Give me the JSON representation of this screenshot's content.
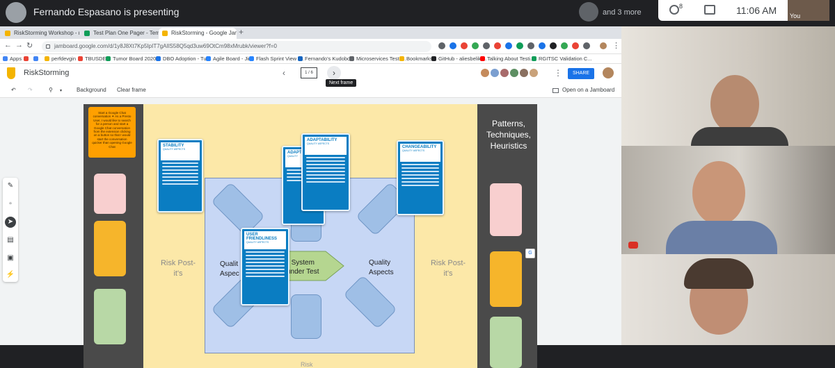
{
  "meet": {
    "presenter_text": "Fernando Espasano is presenting",
    "more_text": "and 3 more",
    "people_count": "8",
    "clock": "11:06 AM",
    "self_label": "You"
  },
  "browser": {
    "tabs": [
      {
        "label": "RiskStorming Workshop - main",
        "color": "#f4b400"
      },
      {
        "label": "Test Plan One Pager - Template",
        "color": "#0f9d58"
      },
      {
        "label": "RiskStorming - Google Jamboard",
        "color": "#f4b400"
      }
    ],
    "new_tab": "+",
    "url": "jamboard.google.com/d/1y8J8Xt7Kp5IpIT7gAIlS58Q5qd3uw69OtCm98xMrubk/viewer?f=0",
    "bookmarks": [
      {
        "label": "Apps",
        "color": "#4285f4"
      },
      {
        "label": "",
        "color": "#ea4335"
      },
      {
        "label": "",
        "color": "#4285f4"
      },
      {
        "label": "perfdevgin",
        "color": "#f4b400"
      },
      {
        "label": "TBUSDEV",
        "color": "#ea4335"
      },
      {
        "label": "Tumor Board 2020...",
        "color": "#0f9d58"
      },
      {
        "label": "DBO Adoption - Tu...",
        "color": "#1a73e8"
      },
      {
        "label": "Agile Board - Jira",
        "color": "#2684ff"
      },
      {
        "label": "Flash Sprint View -...",
        "color": "#2684ff"
      },
      {
        "label": "Fernando's Kudobo...",
        "color": "#1565c0"
      },
      {
        "label": "Microservices Tests...",
        "color": "#5f6368"
      },
      {
        "label": "Bookmarks",
        "color": "#f4b400"
      },
      {
        "label": "GitHub - aliesbelik/...",
        "color": "#202124"
      },
      {
        "label": "Talking About Testi...",
        "color": "#ff0000"
      },
      {
        "label": "RGITSC Validation C...",
        "color": "#0f9d58"
      }
    ]
  },
  "jam": {
    "title": "RiskStorming",
    "frame_counter": "1 / 6",
    "tooltip": "Next frame",
    "share": "SHARE",
    "toolbar": {
      "background": "Background",
      "clear_frame": "Clear frame",
      "open": "Open on a Jamboard"
    },
    "collaborators": [
      "#c58b5c",
      "#7b9fd0",
      "#a86b6b",
      "#5e8f63",
      "#8a7060",
      "#c9a27a"
    ],
    "board": {
      "orange_note": "Start a Google Chat conversation ✦ As a Presto User, I would like to search for a person and start a Google Chat conversation from the extension clicking on a button so that I would start the conversation quicker than opening Google Chat",
      "risk_left": "Risk Post-it's",
      "risk_right": "Risk Post-it's",
      "quality_left_1": "Qualit",
      "quality_left_2": "Aspec",
      "sut_1": "System",
      "sut_2": "under Test",
      "quality_right_1": "Quality",
      "quality_right_2": "Aspects",
      "patterns": "Patterns, Techniques, Heuristics",
      "bottom_risk": "Risk",
      "cards": {
        "stability": {
          "title": "STABILITY",
          "sub": "QUALITY ASPECTS"
        },
        "adaptability_back": {
          "title": "ADAPT",
          "sub": "QUALITY"
        },
        "adaptability": {
          "title": "ADAPTABILITY",
          "sub": "QUALITY ASPECTS"
        },
        "changeability": {
          "title": "CHANGEABILITY",
          "sub": "QUALITY ASPECTS"
        },
        "user_friendliness": {
          "title": "USER FRIENDLINESS",
          "sub": "QUALITY ASPECTS"
        }
      }
    }
  }
}
